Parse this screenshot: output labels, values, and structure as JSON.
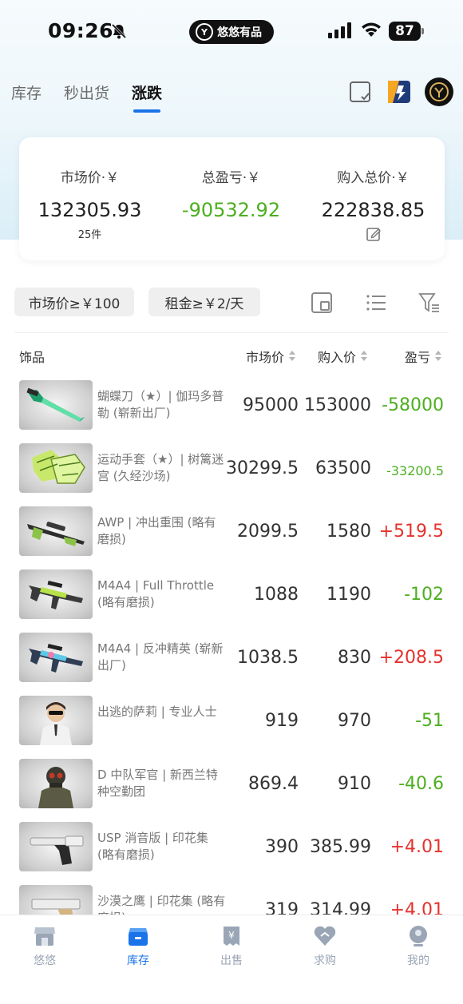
{
  "status_bar": {
    "time": "09:26",
    "app_name": "悠悠有品",
    "battery": "87"
  },
  "tabs": [
    {
      "label": "库存",
      "active": false
    },
    {
      "label": "秒出货",
      "active": false
    },
    {
      "label": "涨跌",
      "active": true
    }
  ],
  "summary": {
    "market": {
      "label": "市场价·￥",
      "value": "132305.93",
      "sub": "25件"
    },
    "profit": {
      "label": "总盈亏·￥",
      "value": "-90532.92"
    },
    "cost": {
      "label": "购入总价·￥",
      "value": "222838.85"
    }
  },
  "filters": {
    "chip1": "市场价≥￥100",
    "chip2": "租金≥￥2/天"
  },
  "table": {
    "headers": {
      "name": "饰品",
      "market": "市场价",
      "buy": "购入价",
      "pl": "盈亏"
    },
    "rows": [
      {
        "name": "蝴蝶刀（★）| 伽玛多普勒 (崭新出厂)",
        "market": "95000",
        "buy": "153000",
        "pl": "-58000",
        "sign": "neg",
        "icon": "knife-icon"
      },
      {
        "name": "运动手套（★）| 树篱迷宫 (久经沙场)",
        "market": "30299.5",
        "buy": "63500",
        "pl": "-33200.5",
        "sign": "neg",
        "icon": "gloves-icon"
      },
      {
        "name": "AWP | 冲出重围 (略有磨损)",
        "market": "2099.5",
        "buy": "1580",
        "pl": "+519.5",
        "sign": "pos",
        "icon": "sniper-rifle-icon"
      },
      {
        "name": "M4A4 | Full Throttle (略有磨损)",
        "market": "1088",
        "buy": "1190",
        "pl": "-102",
        "sign": "neg",
        "icon": "rifle-icon"
      },
      {
        "name": "M4A4 | 反冲精英 (崭新出厂)",
        "market": "1038.5",
        "buy": "830",
        "pl": "+208.5",
        "sign": "pos",
        "icon": "rifle-icon"
      },
      {
        "name": "出逃的萨莉 | 专业人士",
        "market": "919",
        "buy": "970",
        "pl": "-51",
        "sign": "neg",
        "icon": "agent-icon"
      },
      {
        "name": "D 中队军官 | 新西兰特种空勤团",
        "market": "869.4",
        "buy": "910",
        "pl": "-40.6",
        "sign": "neg",
        "icon": "soldier-icon"
      },
      {
        "name": "USP 消音版 | 印花集 (略有磨损)",
        "market": "390",
        "buy": "385.99",
        "pl": "+4.01",
        "sign": "pos",
        "icon": "pistol-icon"
      },
      {
        "name": "沙漠之鹰 | 印花集 (略有磨损)",
        "market": "319",
        "buy": "314.99",
        "pl": "+4.01",
        "sign": "pos",
        "icon": "pistol-icon"
      }
    ]
  },
  "bottom_nav": [
    {
      "label": "悠悠",
      "icon": "store-icon",
      "active": false
    },
    {
      "label": "库存",
      "icon": "inventory-icon",
      "active": true
    },
    {
      "label": "出售",
      "icon": "sell-icon",
      "active": false
    },
    {
      "label": "求购",
      "icon": "wish-icon",
      "active": false
    },
    {
      "label": "我的",
      "icon": "profile-icon",
      "active": false
    }
  ],
  "colors": {
    "accent": "#1a73e8",
    "loss": "#4caf20",
    "gain": "#e5322d"
  }
}
